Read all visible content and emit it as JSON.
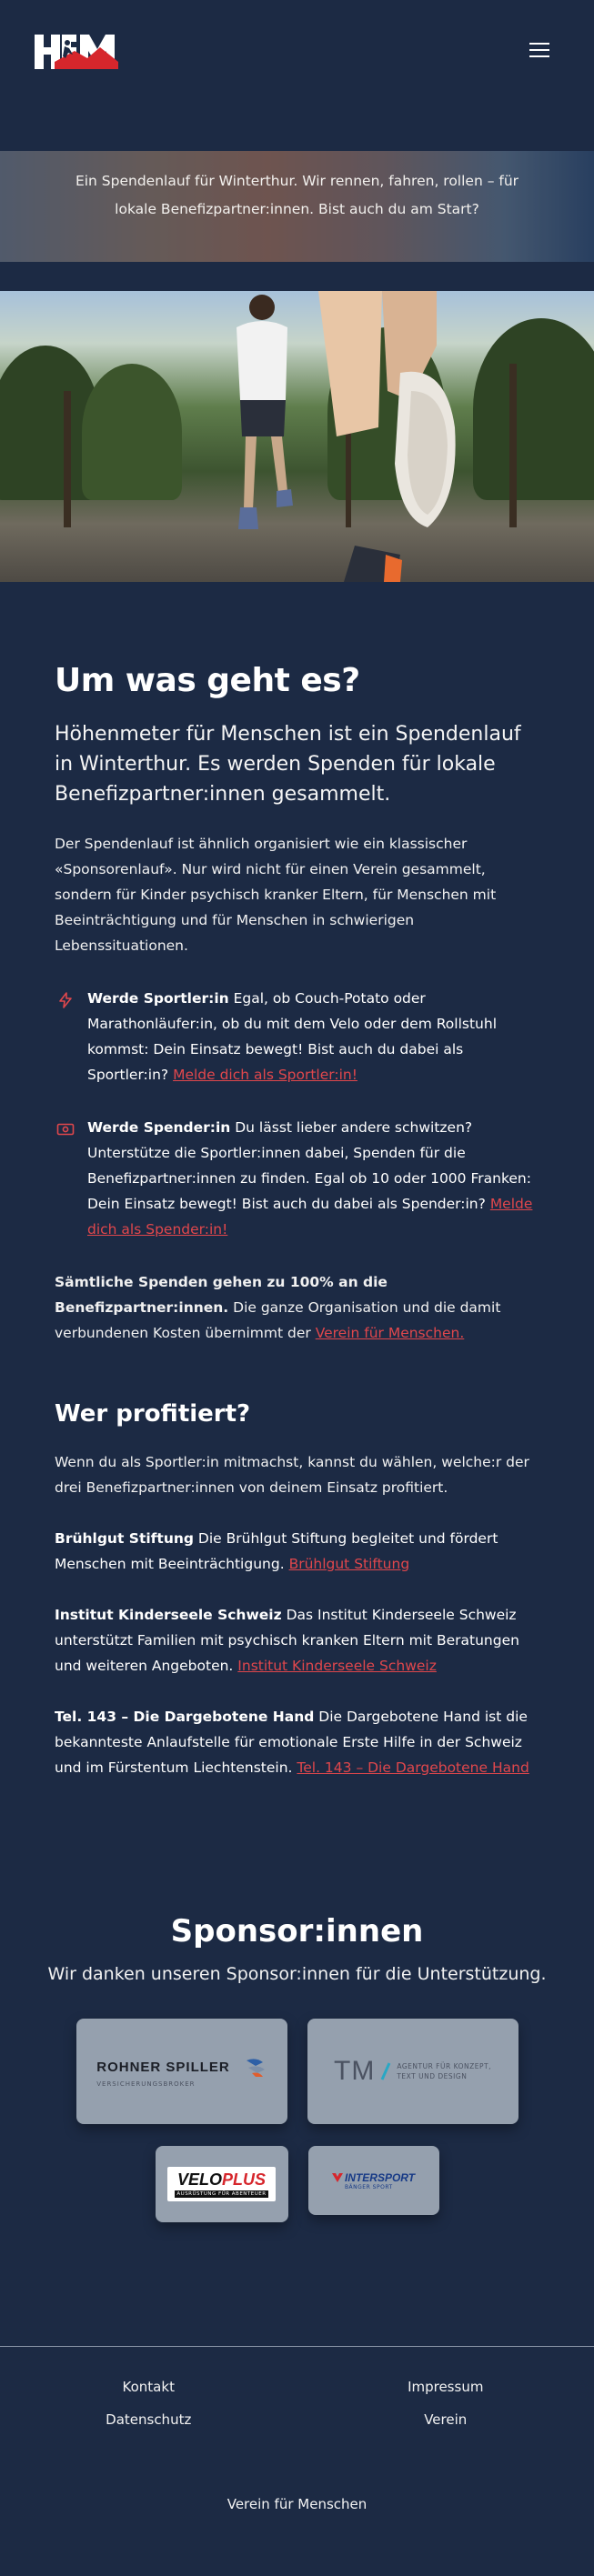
{
  "header": {
    "logo_alt": "HfM",
    "menu_icon": "hamburger-menu-icon"
  },
  "hero": {
    "text": "Ein Spendenlauf für Winterthur. Wir rennen, fahren, rollen – für lokale Benefizpartner:innen. Bist auch du am Start?"
  },
  "about": {
    "title": "Um was geht es?",
    "lead": "Höhenmeter für Menschen ist ein Spendenlauf in Winterthur. Es werden Spenden für lokale Benefizpartner:innen gesammelt.",
    "intro": "Der Spendenlauf ist ähnlich organisiert wie ein klassischer «Sponsorenlauf». Nur wird nicht für einen Verein gesammelt, sondern für Kinder psychisch kranker Eltern, für Menschen mit Beeinträchtigung und für Menschen in schwierigen Lebenssituationen.",
    "features": [
      {
        "icon": "lightning-icon",
        "title": "Werde Sportler:in",
        "text": "Egal, ob Couch-Potato oder Marathonläufer:in, ob du mit dem Velo oder dem Rollstuhl kommst: Dein Einsatz bewegt! Bist auch du dabei als Sportler:in?",
        "link": "Melde dich als Sportler:in!"
      },
      {
        "icon": "money-icon",
        "title": "Werde Spender:in",
        "text": "Du lässt lieber andere schwitzen? Unterstütze die Sportler:innen dabei, Spenden für die Benefizpartner:innen zu finden. Egal ob 10 oder 1000 Franken: Dein Einsatz bewegt! Bist auch du dabei als Spender:in?",
        "link": "Melde dich als Spender:in!"
      }
    ],
    "donation_bold": "Sämtliche Spenden gehen zu 100% an die Benefizpartner:innen.",
    "donation_text": "Die ganze Organisation und die damit verbundenen Kosten übernimmt der",
    "donation_link": "Verein für Menschen."
  },
  "beneficiaries": {
    "title": "Wer profitiert?",
    "intro": "Wenn du als Sportler:in mitmachst, kannst du wählen, welche:r der drei Benefizpartner:innen von deinem Einsatz profitiert.",
    "items": [
      {
        "name": "Brühlgut Stiftung",
        "text": "Die Brühlgut Stiftung begleitet und fördert Menschen mit Beeinträchtigung.",
        "link": "Brühlgut Stiftung"
      },
      {
        "name": "Institut Kinderseele Schweiz",
        "text": "Das Institut Kinderseele Schweiz unterstützt Familien mit psychisch kranken Eltern mit Beratungen und weiteren Angeboten.",
        "link": "Institut Kinderseele Schweiz"
      },
      {
        "name": "Tel. 143 – Die Dargebotene Hand",
        "text": "Die Dargebotene Hand ist die bekannteste Anlaufstelle für emotionale Erste Hilfe in der Schweiz und im Fürstentum Liechtenstein.",
        "link": "Tel. 143 – Die Dargebotene Hand"
      }
    ]
  },
  "sponsors": {
    "title": "Sponsor:innen",
    "subtitle": "Wir danken unseren Sponsor:innen für die Unterstützung.",
    "logos": {
      "rohner": "ROHNER SPILLER",
      "rohner_sub": "VERSICHERUNGSBROKER",
      "tm": "TM",
      "tm_sub1": "AGENTUR FÜR KONZEPT,",
      "tm_sub2": "TEXT UND DESIGN",
      "velo_a": "VELO",
      "velo_b": "PLUS",
      "velo_sub": "AUSRÜSTUNG FÜR ABENTEUER",
      "intersport": "INTERSPORT",
      "intersport_sub": "BÄNGER SPORT"
    }
  },
  "footer": {
    "kontakt": "Kontakt",
    "datenschutz": "Datenschutz",
    "impressum": "Impressum",
    "verein": "Verein",
    "bottom": "Verein für Menschen"
  },
  "colors": {
    "background": "#1c2a44",
    "accent": "#e0474c",
    "card": "#95a0ae"
  }
}
